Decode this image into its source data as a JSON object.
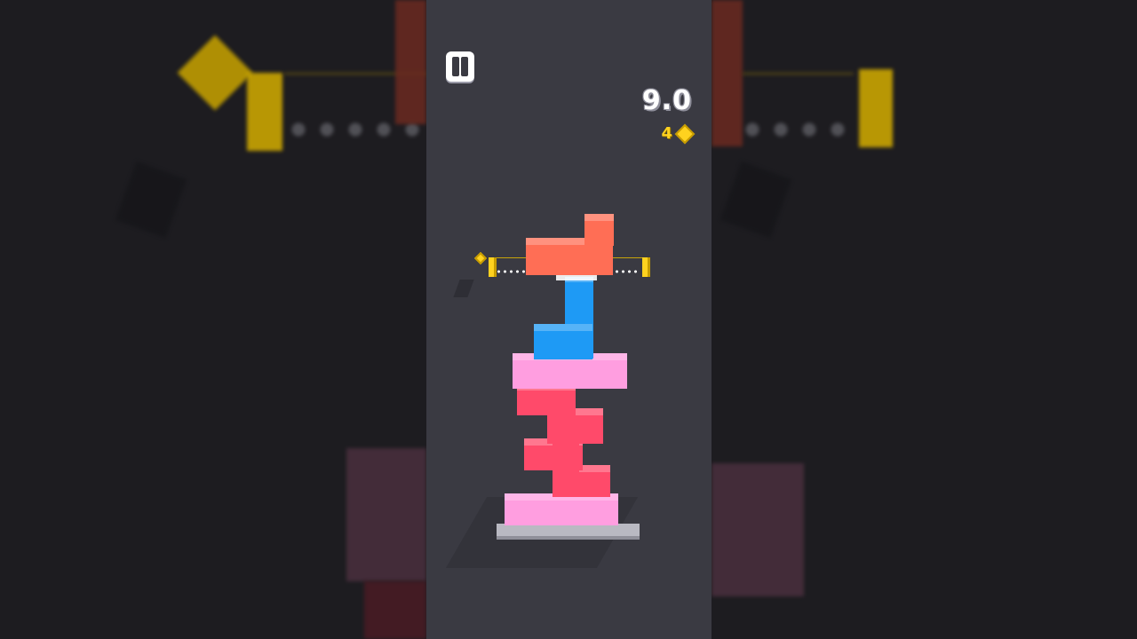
{
  "hud": {
    "score": "9.0",
    "gems": "4",
    "pause_icon": "pause-icon",
    "gem_icon": "gem-icon"
  },
  "colors": {
    "game_bg": "#3a3a42",
    "side_bg": "#1d1c20",
    "orange_piece": "#ff6e55",
    "blue_piece": "#1e9af5",
    "pink_slab": "#ff9ee0",
    "red_piece": "#ff4a6a",
    "gold": "#ffd21f",
    "base": "#b9b9c2"
  }
}
